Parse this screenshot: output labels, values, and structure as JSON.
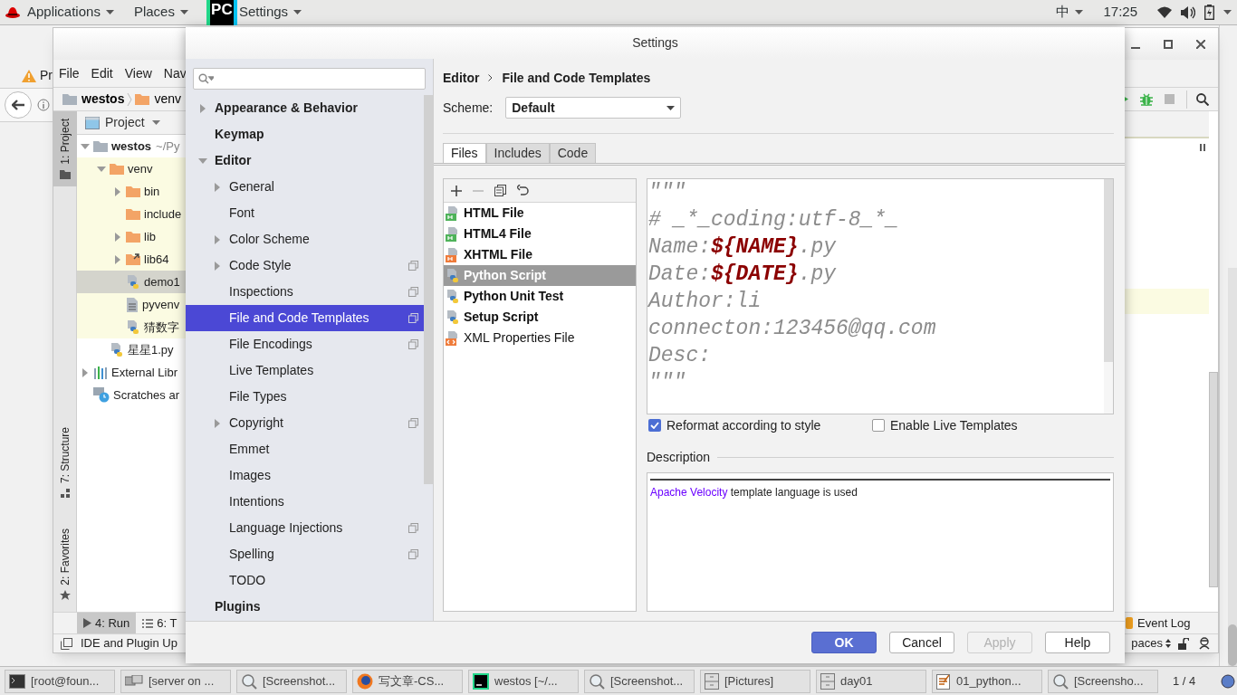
{
  "top_bar": {
    "menus": [
      {
        "label": "Applications"
      },
      {
        "label": "Places"
      },
      {
        "label": "Settings"
      }
    ],
    "logo_text": "PC",
    "input_method": "中",
    "clock": "17:25"
  },
  "browser": {
    "tab_title": "Pr"
  },
  "ide": {
    "menu": [
      "File",
      "Edit",
      "View",
      "Nav"
    ],
    "breadcrumb": [
      "westos",
      "venv"
    ],
    "side_tabs": [
      {
        "label": "1: Project",
        "kind": "project",
        "selected": true
      },
      {
        "label": "7: Structure",
        "kind": "structure",
        "selected": false
      },
      {
        "label": "2: Favorites",
        "kind": "favorites",
        "selected": false
      }
    ],
    "project_title": "Project",
    "tree": [
      {
        "label": "westos",
        "hint": "~/Py",
        "kind": "project-folder",
        "expanded": true,
        "highlighted": false,
        "selected": false,
        "children": [
          {
            "label": "venv",
            "kind": "folder",
            "expanded": true,
            "highlighted": true,
            "selected": false,
            "children": [
              {
                "label": "bin",
                "kind": "folder",
                "expanded": false,
                "highlighted": true,
                "selected": false
              },
              {
                "label": "include",
                "kind": "folder",
                "highlighted": true,
                "selected": false
              },
              {
                "label": "lib",
                "kind": "folder",
                "expanded": false,
                "highlighted": true,
                "selected": false
              },
              {
                "label": "lib64",
                "kind": "folder-link",
                "expanded": false,
                "highlighted": true,
                "selected": false
              },
              {
                "label": "demo1",
                "kind": "python",
                "highlighted": true,
                "selected": true
              },
              {
                "label": "pyvenv",
                "kind": "text",
                "highlighted": true,
                "selected": false
              },
              {
                "label": "猜数字",
                "kind": "python",
                "highlighted": true,
                "selected": false
              }
            ]
          },
          {
            "label": "星星1.py",
            "kind": "python",
            "highlighted": false,
            "selected": false
          }
        ]
      },
      {
        "label": "External Libr",
        "kind": "libraries",
        "expanded": false,
        "highlighted": false,
        "selected": false
      },
      {
        "label": "Scratches ar",
        "kind": "scratches",
        "highlighted": false,
        "selected": false
      }
    ],
    "tool_tabs": [
      {
        "label": "4: Run",
        "kind": "run",
        "selected": true
      },
      {
        "label": "6: T",
        "kind": "todo",
        "selected": false
      }
    ],
    "status": "IDE and Plugin Up",
    "event_log": "Event Log",
    "status_right": "paces"
  },
  "settings": {
    "title": "Settings",
    "tree": [
      {
        "label": "Appearance & Behavior",
        "expanded": false,
        "scoped": false,
        "selected": false
      },
      {
        "label": "Keymap",
        "scoped": false,
        "selected": false
      },
      {
        "label": "Editor",
        "expanded": true,
        "scoped": false,
        "selected": false,
        "children": [
          {
            "label": "General",
            "expanded": false,
            "scoped": false,
            "selected": false
          },
          {
            "label": "Font",
            "scoped": false,
            "selected": false
          },
          {
            "label": "Color Scheme",
            "expanded": false,
            "scoped": false,
            "selected": false
          },
          {
            "label": "Code Style",
            "expanded": false,
            "scoped": true,
            "selected": false
          },
          {
            "label": "Inspections",
            "scoped": true,
            "selected": false
          },
          {
            "label": "File and Code Templates",
            "scoped": true,
            "selected": true
          },
          {
            "label": "File Encodings",
            "scoped": true,
            "selected": false
          },
          {
            "label": "Live Templates",
            "scoped": false,
            "selected": false
          },
          {
            "label": "File Types",
            "scoped": false,
            "selected": false
          },
          {
            "label": "Copyright",
            "expanded": false,
            "scoped": true,
            "selected": false
          },
          {
            "label": "Emmet",
            "scoped": false,
            "selected": false
          },
          {
            "label": "Images",
            "scoped": false,
            "selected": false
          },
          {
            "label": "Intentions",
            "scoped": false,
            "selected": false
          },
          {
            "label": "Language Injections",
            "scoped": true,
            "selected": false
          },
          {
            "label": "Spelling",
            "scoped": true,
            "selected": false
          },
          {
            "label": "TODO",
            "scoped": false,
            "selected": false
          }
        ]
      },
      {
        "label": "Plugins",
        "scoped": false,
        "selected": false
      }
    ],
    "breadcrumb": [
      "Editor",
      "File and Code Templates"
    ],
    "scheme": {
      "label": "Scheme:",
      "value": "Default"
    },
    "tabs": [
      {
        "label": "Files",
        "selected": true
      },
      {
        "label": "Includes",
        "selected": false
      },
      {
        "label": "Code",
        "selected": false
      }
    ],
    "templates": [
      {
        "label": "HTML File",
        "kind": "html",
        "modified": true,
        "selected": false
      },
      {
        "label": "HTML4 File",
        "kind": "html",
        "modified": true,
        "selected": false
      },
      {
        "label": "XHTML File",
        "kind": "xhtml",
        "modified": true,
        "selected": false
      },
      {
        "label": "Python Script",
        "kind": "python",
        "modified": true,
        "selected": true
      },
      {
        "label": "Python Unit Test",
        "kind": "python",
        "modified": true,
        "selected": false
      },
      {
        "label": "Setup Script",
        "kind": "python",
        "modified": true,
        "selected": false
      },
      {
        "label": "XML Properties File",
        "kind": "xml",
        "modified": false,
        "selected": false
      }
    ],
    "editor_lines": [
      [
        {
          "text": "\"\"\"",
          "kind": "text"
        }
      ],
      [
        {
          "text": "# _*_coding:utf-8_*_",
          "kind": "text"
        }
      ],
      [
        {
          "text": "Name:",
          "kind": "text"
        },
        {
          "text": "${NAME}",
          "kind": "variable"
        },
        {
          "text": ".py",
          "kind": "text"
        }
      ],
      [
        {
          "text": "Date:",
          "kind": "text"
        },
        {
          "text": "${DATE}",
          "kind": "variable"
        },
        {
          "text": ".py",
          "kind": "text"
        }
      ],
      [
        {
          "text": "Author:li",
          "kind": "text"
        }
      ],
      [
        {
          "text": "connecton:123456@qq.com",
          "kind": "text"
        }
      ],
      [
        {
          "text": "Desc:",
          "kind": "text"
        }
      ],
      [
        {
          "text": "\"\"\"",
          "kind": "text"
        }
      ]
    ],
    "options": [
      {
        "label": "Reformat according to style",
        "checked": true
      },
      {
        "label": "Enable Live Templates",
        "checked": false
      }
    ],
    "description": {
      "title": "Description",
      "link": "Apache Velocity",
      "text": "template language is used"
    },
    "buttons": [
      {
        "label": "OK",
        "kind": "primary",
        "disabled": false
      },
      {
        "label": "Cancel",
        "kind": "normal",
        "disabled": false
      },
      {
        "label": "Apply",
        "kind": "normal",
        "disabled": true
      },
      {
        "label": "Help",
        "kind": "normal",
        "disabled": false
      }
    ]
  },
  "taskbar": {
    "items": [
      {
        "label": "[root@foun...",
        "kind": "terminal"
      },
      {
        "label": "[server on ...",
        "kind": "virt"
      },
      {
        "label": "[Screenshot...",
        "kind": "screenshot"
      },
      {
        "label": "写文章-CS...",
        "kind": "firefox"
      },
      {
        "label": "westos [~/...",
        "kind": "pycharm"
      },
      {
        "label": "[Screenshot...",
        "kind": "screenshot"
      },
      {
        "label": "[Pictures]",
        "kind": "files"
      },
      {
        "label": "day01",
        "kind": "files"
      },
      {
        "label": "01_python...",
        "kind": "editor"
      },
      {
        "label": "[Screensho...",
        "kind": "screenshot"
      }
    ],
    "pager": "1 / 4"
  }
}
